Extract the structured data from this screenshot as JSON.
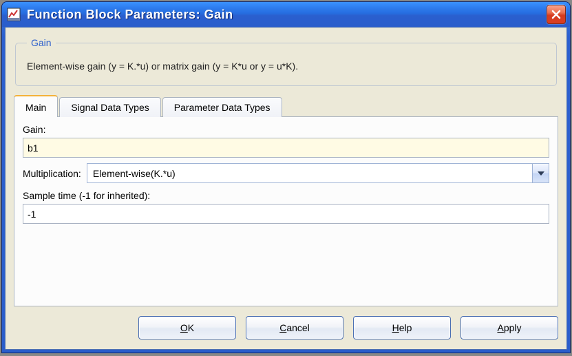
{
  "window": {
    "title": "Function Block Parameters: Gain"
  },
  "group": {
    "legend": "Gain",
    "description": "Element-wise gain (y = K.*u) or matrix gain (y = K*u or y = u*K)."
  },
  "tabs": [
    {
      "label": "Main",
      "active": true
    },
    {
      "label": "Signal Data Types",
      "active": false
    },
    {
      "label": "Parameter Data Types",
      "active": false
    }
  ],
  "fields": {
    "gain": {
      "label": "Gain:",
      "value": "b1"
    },
    "multiplication": {
      "label": "Multiplication:",
      "selected": "Element-wise(K.*u)"
    },
    "sample_time": {
      "label": "Sample time (-1 for inherited):",
      "value": "-1"
    }
  },
  "buttons": {
    "ok": "OK",
    "cancel": "Cancel",
    "help": "Help",
    "apply": "Apply"
  },
  "mnemonics": {
    "ok": "O",
    "cancel": "C",
    "help": "H",
    "apply": "A"
  }
}
